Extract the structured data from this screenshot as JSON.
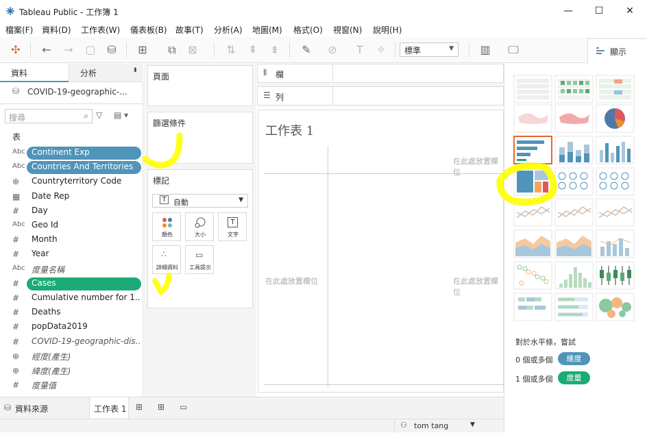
{
  "window": {
    "title": "Tableau Public - 工作簿 1",
    "minimize": "—",
    "maximize": "☐",
    "close": "✕"
  },
  "menu": [
    "檔案(F)",
    "資料(D)",
    "工作表(W)",
    "儀表板(B)",
    "故事(T)",
    "分析(A)",
    "地圖(M)",
    "格式(O)",
    "視窗(N)",
    "說明(H)"
  ],
  "toolbar": {
    "fit_value": "標準",
    "show_me_label": "顯示"
  },
  "left_panel": {
    "tab_data": "資料",
    "tab_analytics": "分析",
    "datasource": "COVID-19-geographic-...",
    "search_placeholder": "搜尋",
    "tables_label": "表",
    "fields": [
      {
        "type": "Abc",
        "name": "Continent Exp",
        "pill": "dim"
      },
      {
        "type": "Abc",
        "name": "Countries And Territories",
        "pill": "dim"
      },
      {
        "type": "globe",
        "name": "Countryterritory Code"
      },
      {
        "type": "date",
        "name": "Date Rep"
      },
      {
        "type": "#",
        "name": "Day"
      },
      {
        "type": "Abc",
        "name": "Geo Id"
      },
      {
        "type": "#",
        "name": "Month"
      },
      {
        "type": "#",
        "name": "Year"
      },
      {
        "type": "Abc",
        "name": "度量名稱",
        "italic": true
      },
      {
        "type": "#",
        "name": "Cases",
        "pill": "measure"
      },
      {
        "type": "#",
        "name": "Cumulative number for 1..."
      },
      {
        "type": "#",
        "name": "Deaths"
      },
      {
        "type": "#",
        "name": "popData2019"
      },
      {
        "type": "#",
        "name": "COVID-19-geographic-dis...",
        "italic": true
      },
      {
        "type": "globe",
        "name": "經度(產生)",
        "italic": true
      },
      {
        "type": "globe",
        "name": "緯度(產生)",
        "italic": true
      },
      {
        "type": "#",
        "name": "度量值",
        "italic": true
      }
    ]
  },
  "cards": {
    "pages": "頁面",
    "filters": "篩選條件",
    "marks": "標記",
    "mark_type": "自動",
    "mark_buttons": [
      "顏色",
      "大小",
      "文字",
      "詳細資料",
      "工具提示"
    ]
  },
  "shelves": {
    "columns": "欄",
    "rows": "列"
  },
  "sheet": {
    "title": "工作表 1",
    "drop_field_top": "在此處放置欄位",
    "drop_field_left": "在此處放置欄位",
    "drop_field_center": "在此處放置欄位"
  },
  "show_me": {
    "hint_title": "對於水平條，嘗試",
    "hint_dim_count": "0 個或多個",
    "hint_dim_label": "維度",
    "hint_measure_count": "1 個或多個",
    "hint_measure_label": "度量"
  },
  "bottom": {
    "datasource_tab": "資料來源",
    "sheet_tab": "工作表 1",
    "user": "tom tang"
  },
  "colors": {
    "dimension_pill": "#4f94b9",
    "measure_pill": "#1bab77",
    "highlight": "#ffff00",
    "selected_chart": "#e2682f"
  }
}
